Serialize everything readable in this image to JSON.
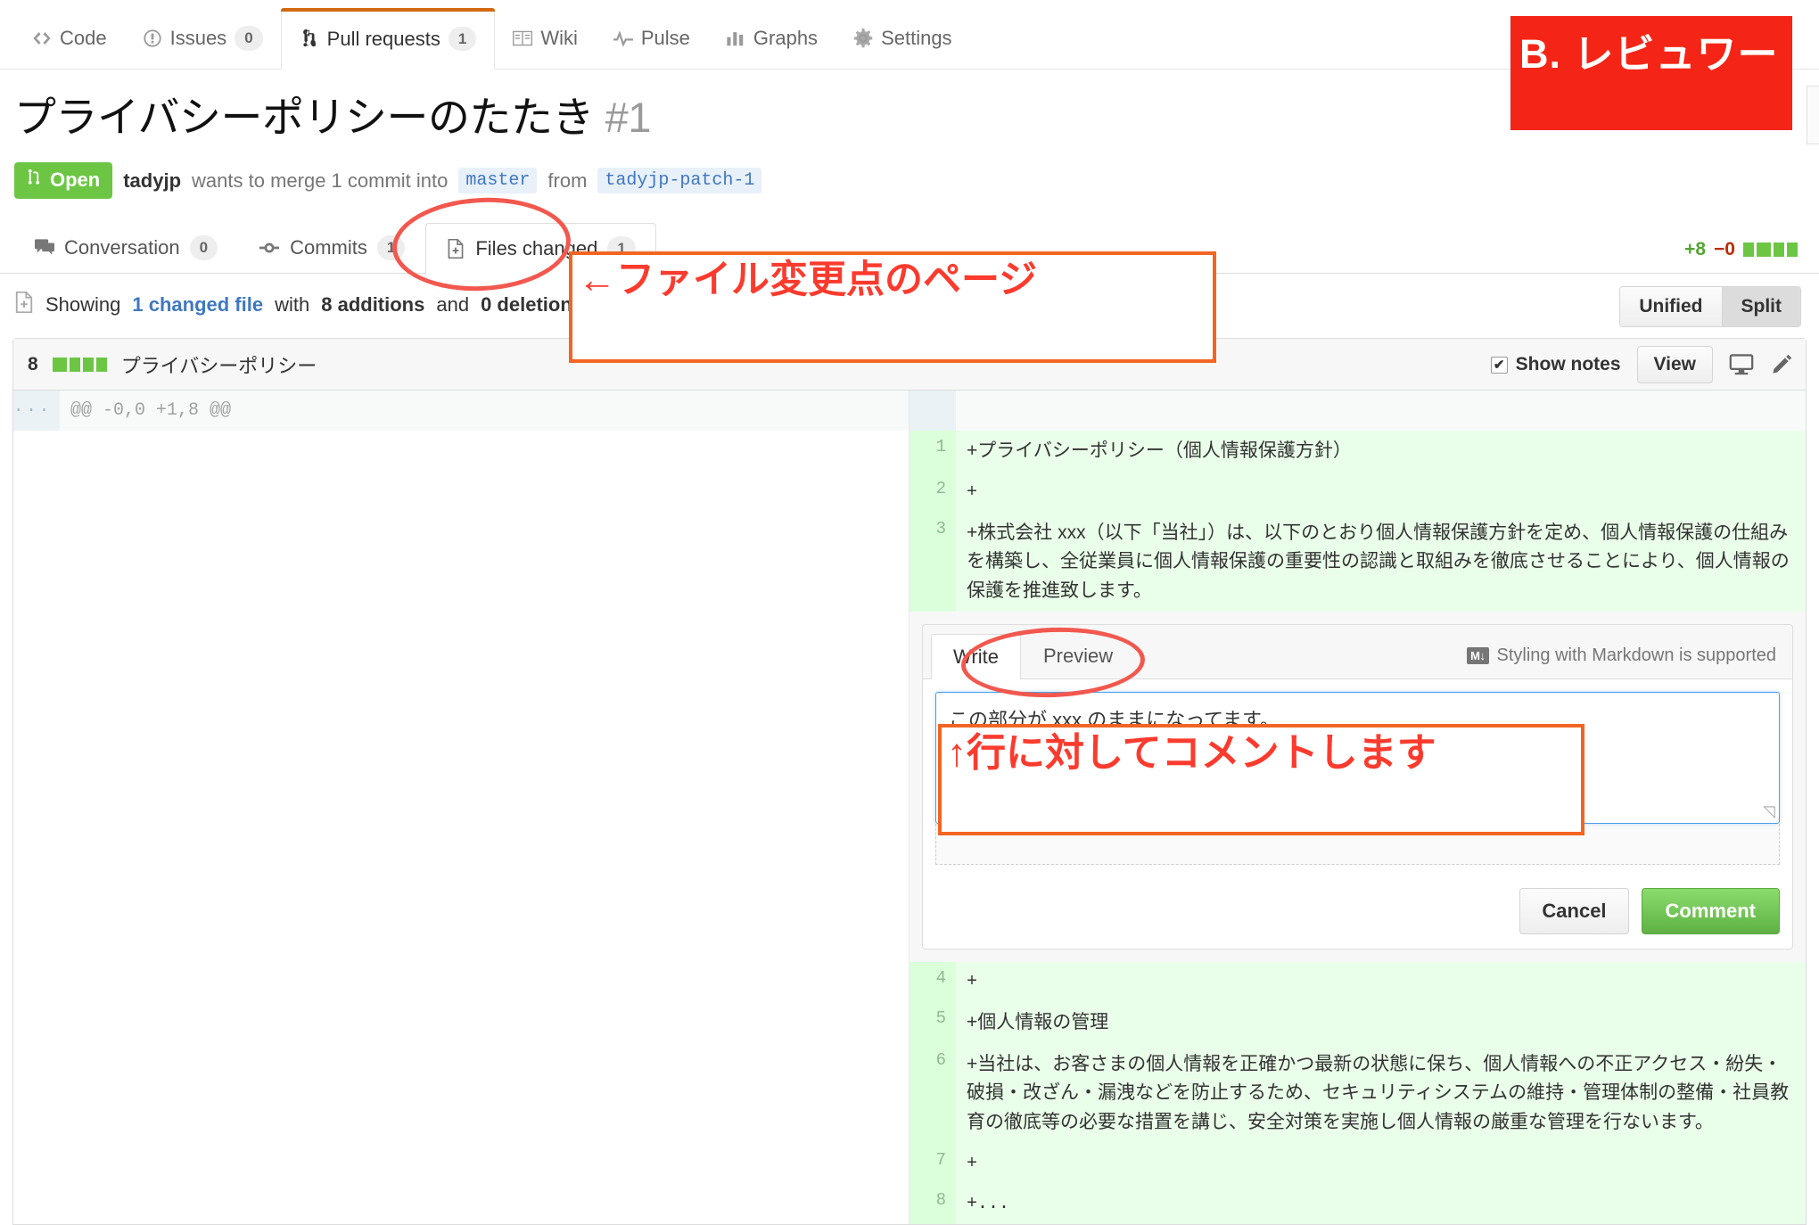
{
  "repo_nav": {
    "tabs": [
      {
        "label": "Code",
        "icon": "code-icon",
        "count": null,
        "selected": false
      },
      {
        "label": "Issues",
        "icon": "issue-opened-icon",
        "count": "0",
        "selected": false
      },
      {
        "label": "Pull requests",
        "icon": "git-pull-request-icon",
        "count": "1",
        "selected": true
      },
      {
        "label": "Wiki",
        "icon": "book-icon",
        "count": null,
        "selected": false
      },
      {
        "label": "Pulse",
        "icon": "pulse-icon",
        "count": null,
        "selected": false
      },
      {
        "label": "Graphs",
        "icon": "graph-icon",
        "count": null,
        "selected": false
      },
      {
        "label": "Settings",
        "icon": "gear-icon",
        "count": null,
        "selected": false
      }
    ]
  },
  "pull_request": {
    "title": "プライバシーポリシーのたたき",
    "number": "#1",
    "state": "Open",
    "author": "tadyjp",
    "merge_text_1": "wants to merge 1 commit into",
    "base_branch": "master",
    "merge_text_2": "from",
    "head_branch": "tadyjp-patch-1",
    "tabs": [
      {
        "label": "Conversation",
        "icon": "comment-discussion-icon",
        "count": "0",
        "selected": false
      },
      {
        "label": "Commits",
        "icon": "git-commit-icon",
        "count": "1",
        "selected": false
      },
      {
        "label": "Files changed",
        "icon": "diff-icon",
        "count": "1",
        "selected": true
      }
    ],
    "diffstat": {
      "additions": "+8",
      "deletions": "−0"
    }
  },
  "showing_bar": {
    "prefix": "Showing",
    "changed_file": "1 changed file",
    "mid": "with",
    "additions": "8 additions",
    "and": "and",
    "deletions": "0 deletions",
    "suffix": ".",
    "view_toggle": [
      {
        "label": "Unified",
        "active": false
      },
      {
        "label": "Split",
        "active": true
      }
    ]
  },
  "file": {
    "changes_count": "8",
    "name": "プライバシーポリシー",
    "show_notes_label": "Show notes",
    "show_notes_checked": true,
    "view_button": "View",
    "icons": [
      "desktop-icon",
      "pencil-icon"
    ],
    "hunk_header": "@@ -0,0 +1,8 @@",
    "hunk_gutter": "...",
    "lines": [
      {
        "num": "1",
        "text": "+プライバシーポリシー（個人情報保護方針）"
      },
      {
        "num": "2",
        "text": "+"
      },
      {
        "num": "3",
        "text": "+株式会社 xxx（以下「当社」）は、以下のとおり個人情報保護方針を定め、個人情報保護の仕組みを構築し、全従業員に個人情報保護の重要性の認識と取組みを徹底させることにより、個人情報の保護を推進致します。"
      }
    ],
    "lines_after": [
      {
        "num": "4",
        "text": "+"
      },
      {
        "num": "5",
        "text": "+個人情報の管理"
      },
      {
        "num": "6",
        "text": "+当社は、お客さまの個人情報を正確かつ最新の状態に保ち、個人情報への不正アクセス・紛失・破損・改ざん・漏洩などを防止するため、セキュリティシステムの維持・管理体制の整備・社員教育の徹底等の必要な措置を講じ、安全対策を実施し個人情報の厳重な管理を行ないます。"
      },
      {
        "num": "7",
        "text": "+"
      },
      {
        "num": "8",
        "text": "+..."
      }
    ]
  },
  "comment_form": {
    "tabs": [
      {
        "label": "Write",
        "selected": true
      },
      {
        "label": "Preview",
        "selected": false
      }
    ],
    "markdown_hint": "Styling with Markdown is supported",
    "markdown_badge": "M↓",
    "textarea_value": "この部分が xxx のままになってます。",
    "cancel_label": "Cancel",
    "comment_label": "Comment"
  },
  "annotations": {
    "banner": "B. レビュワー",
    "note_files_page": "←ファイル変更点のページ",
    "note_line_comment": "↑行に対してコメントします",
    "colors": {
      "banner_bg": "#f42516",
      "note_text": "#fb3b2e",
      "note_border": "#f26522",
      "ellipse": "#f2584e"
    }
  }
}
